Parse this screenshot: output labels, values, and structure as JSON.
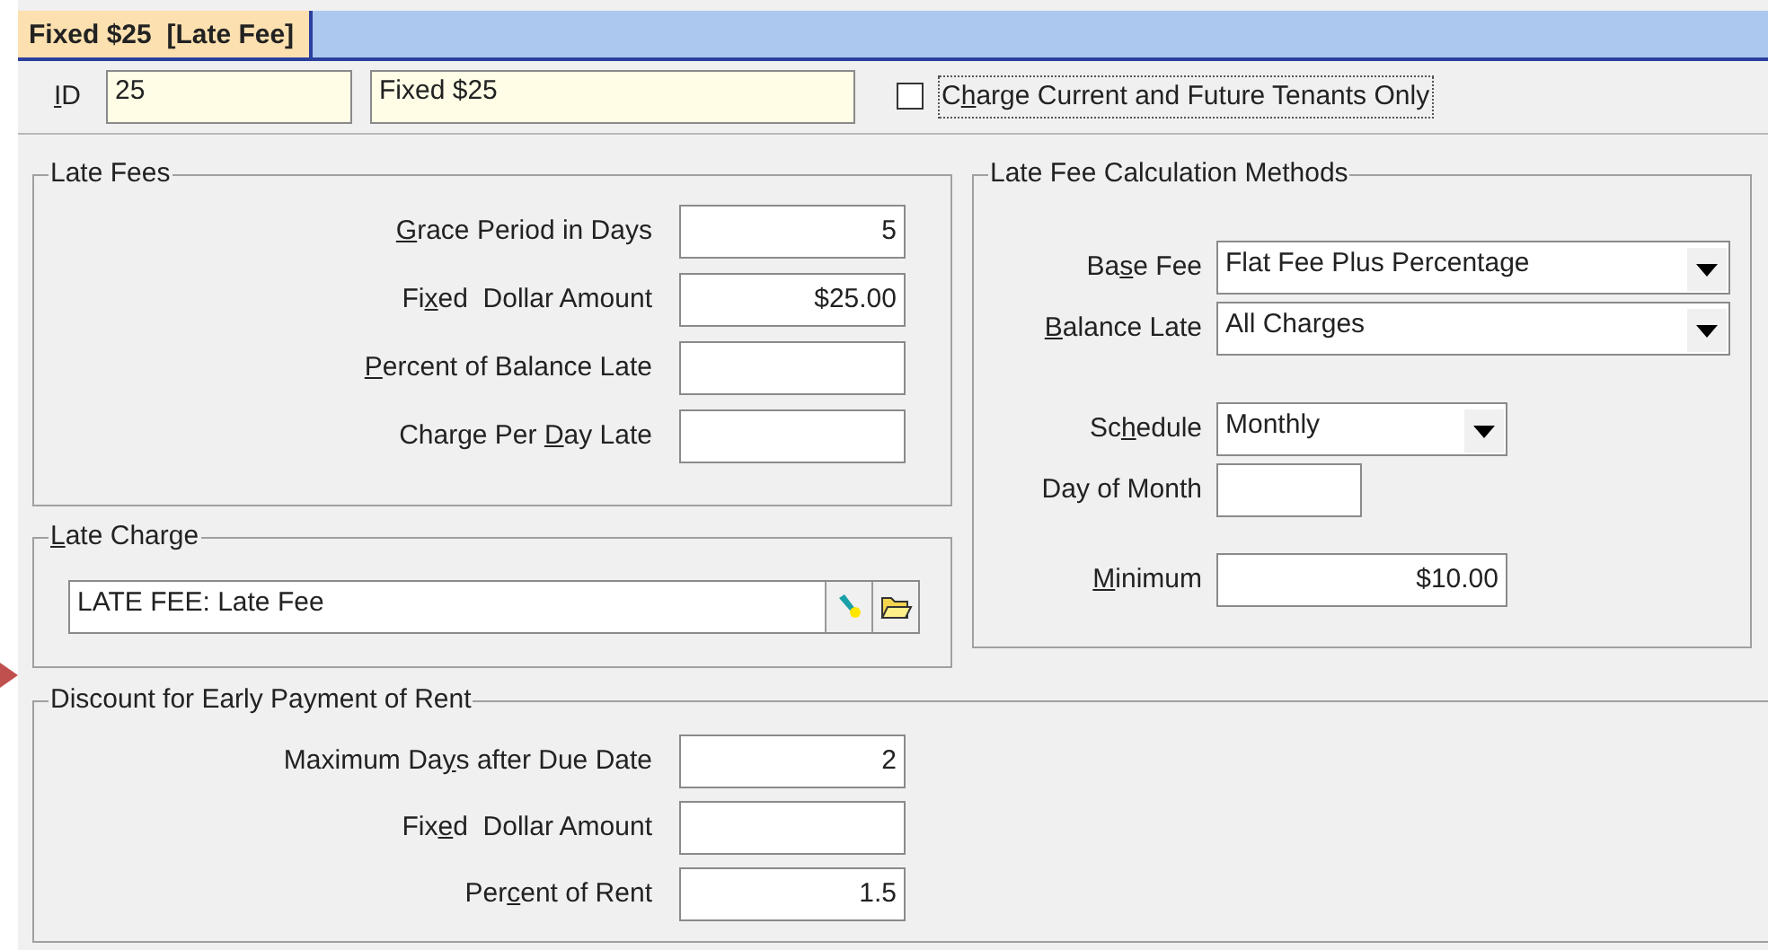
{
  "tab": {
    "title": "Fixed $25  [Late Fee]",
    "selected": true
  },
  "header": {
    "id_label": {
      "access_key": "I",
      "label_end": "D"
    },
    "id_value": "25",
    "name_value": "Fixed $25",
    "checkbox": {
      "label_start": "C",
      "access_key": "h",
      "label_end": "arge Current and Future Tenants Only",
      "checked": false
    }
  },
  "late_fees": {
    "title": "Late Fees",
    "fields": [
      {
        "access_key": "G",
        "label_end": "race Period in Days",
        "value": "5"
      },
      {
        "label_start": "Fi",
        "access_key": "x",
        "label_end": "ed  Dollar Amount",
        "value": "$25.00"
      },
      {
        "access_key": "P",
        "label_end": "ercent of Balance Late"
      },
      {
        "label_start": "Charge Per ",
        "access_key": "D",
        "label_end": "ay Late"
      }
    ]
  },
  "late_charge": {
    "title": {
      "access_key": "L",
      "label_end": "ate Charge"
    },
    "value": "LATE FEE: Late Fee"
  },
  "calculation_methods": {
    "title": "Late Fee Calculation Methods",
    "fields": [
      {
        "kind": "select",
        "label_start": "Ba",
        "access_key": "s",
        "label_end": "e Fee",
        "value": "Flat Fee Plus Percentage"
      },
      {
        "kind": "select",
        "access_key": "B",
        "label_end": "alance Late",
        "value": "All Charges"
      },
      {
        "kind": "select",
        "label_start": "Sc",
        "access_key": "h",
        "label_end": "edule",
        "value": "Monthly"
      },
      {
        "kind": "text",
        "label_start": "Day of Month"
      },
      {
        "kind": "text",
        "access_key": "M",
        "label_end": "inimum",
        "value": "$10.00"
      }
    ]
  },
  "discount": {
    "title": "Discount for Early Payment of Rent",
    "fields": [
      {
        "label_start": "Maximum Da",
        "access_key": "y",
        "label_end": "s after Due Date",
        "value": "2"
      },
      {
        "label_start": "Fix",
        "access_key": "e",
        "label_end": "d  Dollar Amount"
      },
      {
        "label_start": "Per",
        "access_key": "c",
        "label_end": "ent of Rent",
        "value": "1.5"
      }
    ]
  }
}
